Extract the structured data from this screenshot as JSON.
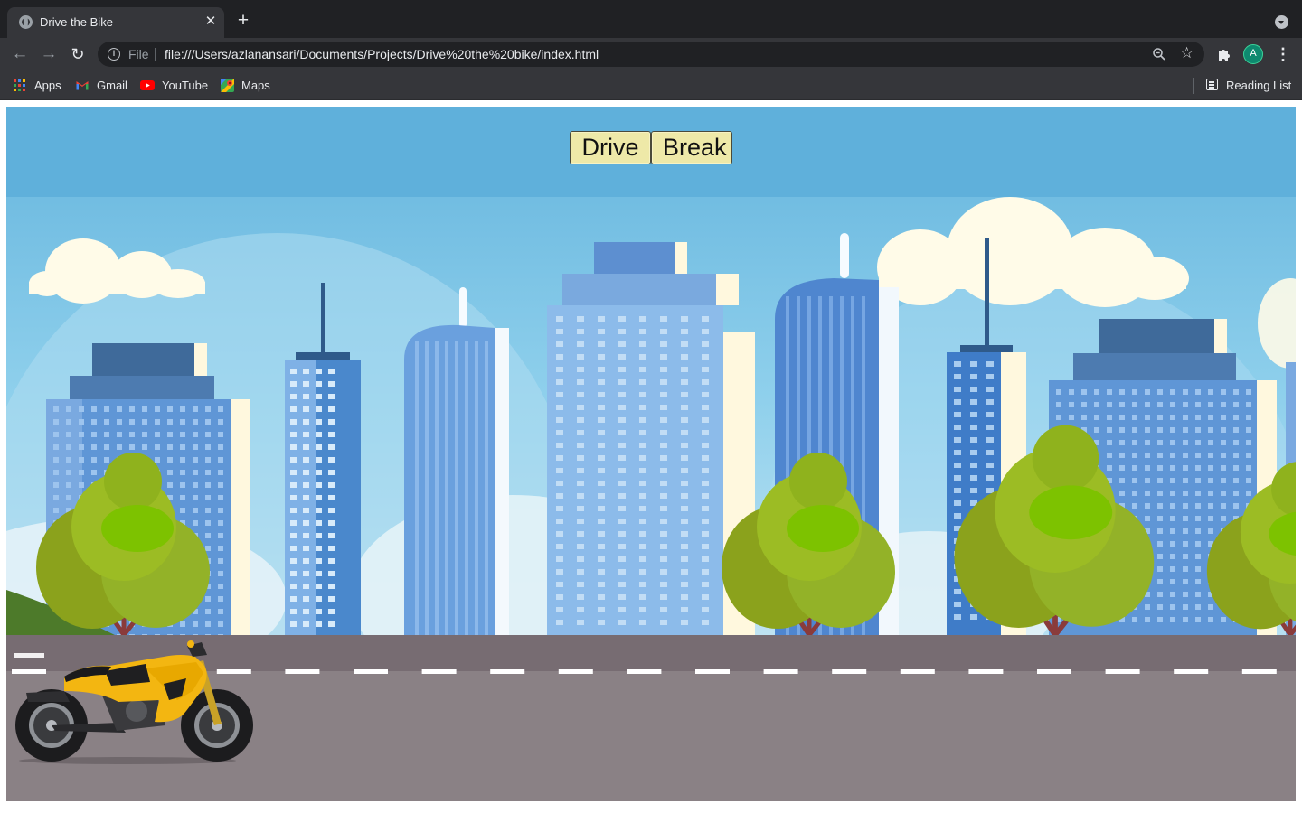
{
  "browser": {
    "tab_title": "Drive the Bike",
    "scheme_label": "File",
    "url": "file:///Users/azlanansari/Documents/Projects/Drive%20the%20bike/index.html",
    "profile_initial": "A",
    "bookmarks": [
      {
        "label": "Apps",
        "icon": "apps-grid-icon"
      },
      {
        "label": "Gmail",
        "icon": "gmail-icon"
      },
      {
        "label": "YouTube",
        "icon": "youtube-icon"
      },
      {
        "label": "Maps",
        "icon": "maps-icon"
      }
    ],
    "reading_list_label": "Reading List",
    "colors": {
      "chrome_dark": "#202124",
      "chrome_toolbar": "#35363a",
      "text": "#e8eaed"
    }
  },
  "game": {
    "drive_label": "Drive",
    "brake_label": "Break",
    "button_color": "#eee9a8",
    "scene_colors": {
      "sky": "#7ec4e4",
      "road": "#8a8185",
      "lane_marking": "#ffffff",
      "tree": "#8fb21d",
      "bike": "#f3b611"
    }
  }
}
